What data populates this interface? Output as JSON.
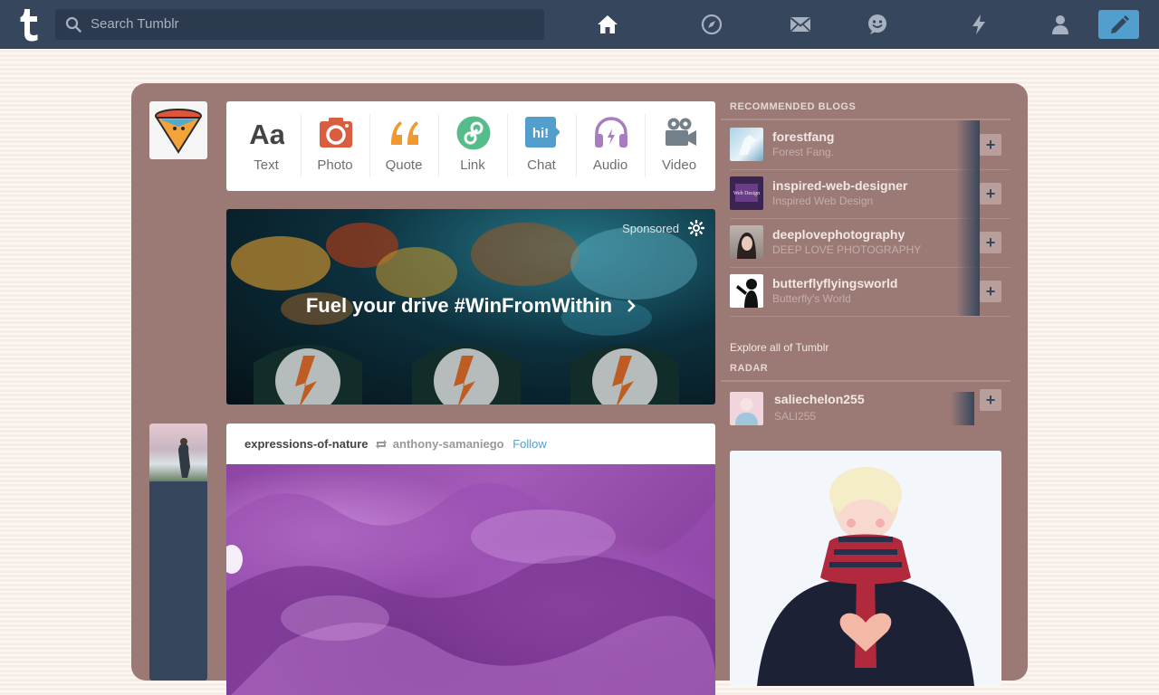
{
  "header": {
    "search_placeholder": "Search Tumblr",
    "nav_icons": [
      "home-icon",
      "explore-icon",
      "inbox-icon",
      "messaging-icon",
      "activity-icon",
      "account-icon",
      "compose-icon"
    ]
  },
  "post_types": [
    {
      "label": "Text",
      "icon": "text-icon",
      "color": "#444444"
    },
    {
      "label": "Photo",
      "icon": "camera-icon",
      "color": "#d95e40"
    },
    {
      "label": "Quote",
      "icon": "quote-icon",
      "color": "#f2992e"
    },
    {
      "label": "Link",
      "icon": "link-icon",
      "color": "#56bc8a"
    },
    {
      "label": "Chat",
      "icon": "chat-icon",
      "color": "#529ecc"
    },
    {
      "label": "Audio",
      "icon": "headphones-icon",
      "color": "#a77dc2"
    },
    {
      "label": "Video",
      "icon": "video-camera-icon",
      "color": "#748089"
    }
  ],
  "sponsored": {
    "label": "Sponsored",
    "headline": "Fuel your drive #WinFromWithin"
  },
  "post": {
    "author": "expressions-of-nature",
    "reblogged_from": "anthony-samaniego",
    "follow_label": "Follow"
  },
  "sidebar": {
    "recommended_heading": "RECOMMENDED BLOGS",
    "blogs": [
      {
        "name": "forestfang",
        "title": "Forest Fang."
      },
      {
        "name": "inspired-web-designer",
        "title": "Inspired Web Design"
      },
      {
        "name": "deeplovephotography",
        "title": "DEEP LOVE PHOTOGRAPHY"
      },
      {
        "name": "butterflyflyingsworld",
        "title": "Butterfly's World"
      }
    ],
    "explore_label": "Explore all of Tumblr",
    "radar_heading": "RADAR",
    "radar": {
      "name": "saliechelon255",
      "title": "SALI255"
    }
  },
  "colors": {
    "header": "#36465d",
    "panel": "#9b7a76",
    "compose": "#529ecc"
  }
}
